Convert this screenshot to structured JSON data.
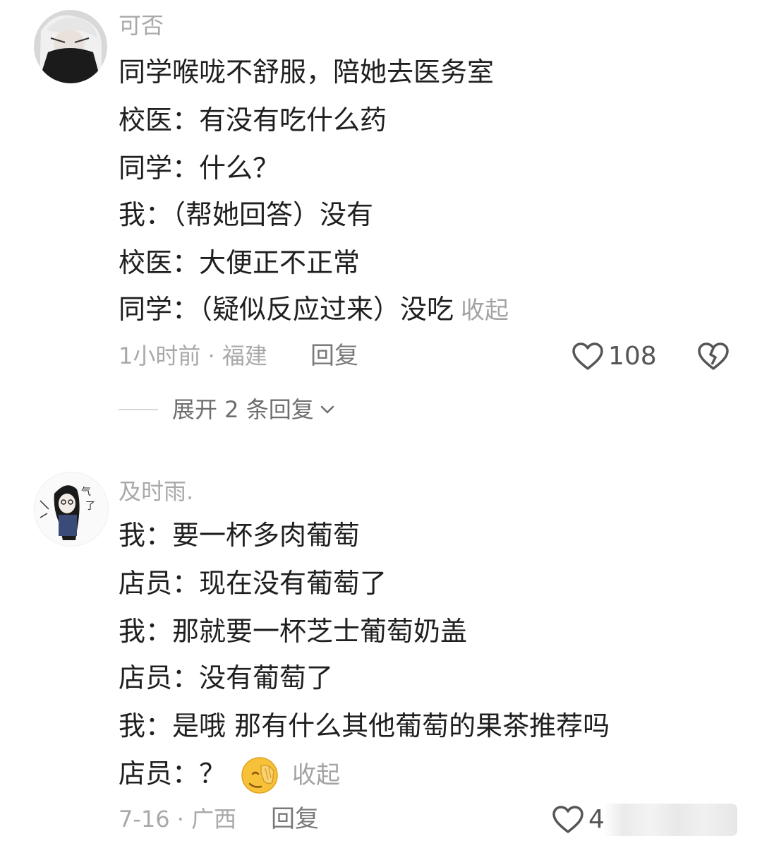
{
  "comments": [
    {
      "username": "可否",
      "lines": [
        "同学喉咙不舒服，陪她去医务室",
        "校医：有没有吃什么药",
        "同学：什么？",
        "我：（帮她回答）没有",
        "校医：大便正不正常",
        "同学：（疑似反应过来）没吃"
      ],
      "collapse_label": "收起",
      "meta": "1小时前 · 福建",
      "reply_label": "回复",
      "likes": "108",
      "expand_label": "展开 2 条回复"
    },
    {
      "username": "及时雨.",
      "lines": [
        "我：要一杯多肉葡萄",
        "店员：现在没有葡萄了",
        "我：那就要一杯芝士葡萄奶盖",
        "店员：没有葡萄了",
        "我：是哦 那有什么其他葡萄的果茶推荐吗",
        "店员：？"
      ],
      "collapse_label": "收起",
      "meta": "7-16 · 广西",
      "reply_label": "回复",
      "likes": "4"
    }
  ],
  "icons": {
    "like": "heart-outline-icon",
    "dislike": "broken-heart-icon",
    "expand": "chevron-down-icon",
    "emoji": "facepalm-emoji"
  },
  "colors": {
    "text": "#1f1f1f",
    "muted": "#a9a9a9",
    "reply": "#7a7a7a"
  }
}
